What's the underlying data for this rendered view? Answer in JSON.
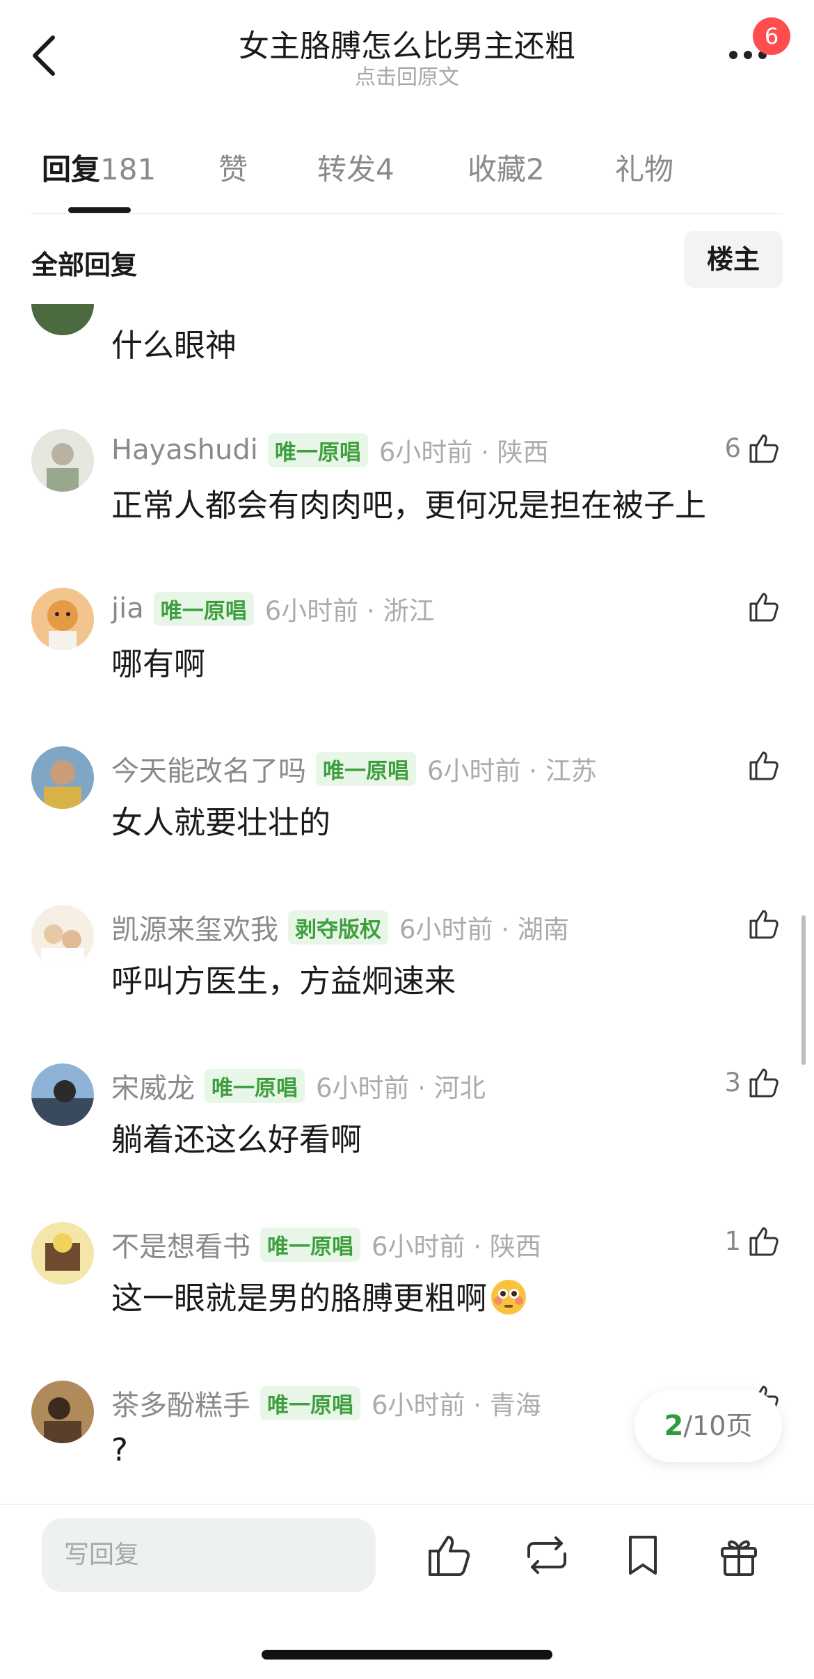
{
  "header": {
    "title": "女主胳膊怎么比男主还粗",
    "subtitle": "点击回原文",
    "notification_count": "6",
    "back_icon": "chevron-left-icon",
    "more_icon": "more-dots-icon"
  },
  "tabs": [
    {
      "label": "回复",
      "count": "181",
      "active": true
    },
    {
      "label": "赞",
      "count": "",
      "active": false
    },
    {
      "label": "转发",
      "count": "4",
      "active": false
    },
    {
      "label": "收藏",
      "count": "2",
      "active": false
    },
    {
      "label": "礼物",
      "count": "",
      "active": false
    }
  ],
  "filter": {
    "label": "全部回复",
    "button": "楼主"
  },
  "partial_comment": {
    "text": "什么眼神"
  },
  "comments": [
    {
      "name": "Hayashudi",
      "tag": "唯一原唱",
      "time": "6小时前 · 陕西",
      "text": "正常人都会有肉肉吧，更何况是担在被子上",
      "likes": "6"
    },
    {
      "name": "jia",
      "tag": "唯一原唱",
      "time": "6小时前 · 浙江",
      "text": "哪有啊",
      "likes": ""
    },
    {
      "name": "今天能改名了吗",
      "tag": "唯一原唱",
      "time": "6小时前 · 江苏",
      "text": "女人就要壮壮的",
      "likes": ""
    },
    {
      "name": "凯源来玺欢我",
      "tag": "剥夺版权",
      "time": "6小时前 · 湖南",
      "text": "呼叫方医生，方益炯速来",
      "likes": ""
    },
    {
      "name": "宋威龙",
      "tag": "唯一原唱",
      "time": "6小时前 · 河北",
      "text": "躺着还这么好看啊",
      "likes": "3"
    },
    {
      "name": "不是想看书",
      "tag": "唯一原唱",
      "time": "6小时前 · 陕西",
      "text": "这一眼就是男的胳膊更粗啊",
      "likes": "1"
    },
    {
      "name": "茶多酚糕手",
      "tag": "唯一原唱",
      "time": "6小时前 · 青海",
      "text": "?",
      "likes": ""
    }
  ],
  "pagination": {
    "current": "2",
    "total": "/10",
    "unit": "页"
  },
  "bottom_bar": {
    "reply_placeholder": "写回复",
    "icons": [
      "like-icon",
      "repost-icon",
      "bookmark-icon",
      "gift-icon"
    ]
  },
  "colors": {
    "accent_green": "#2e9b3e",
    "tag_bg": "#e8f6e8",
    "tag_text": "#3f9f3f",
    "badge_red": "#ff4d4f"
  }
}
